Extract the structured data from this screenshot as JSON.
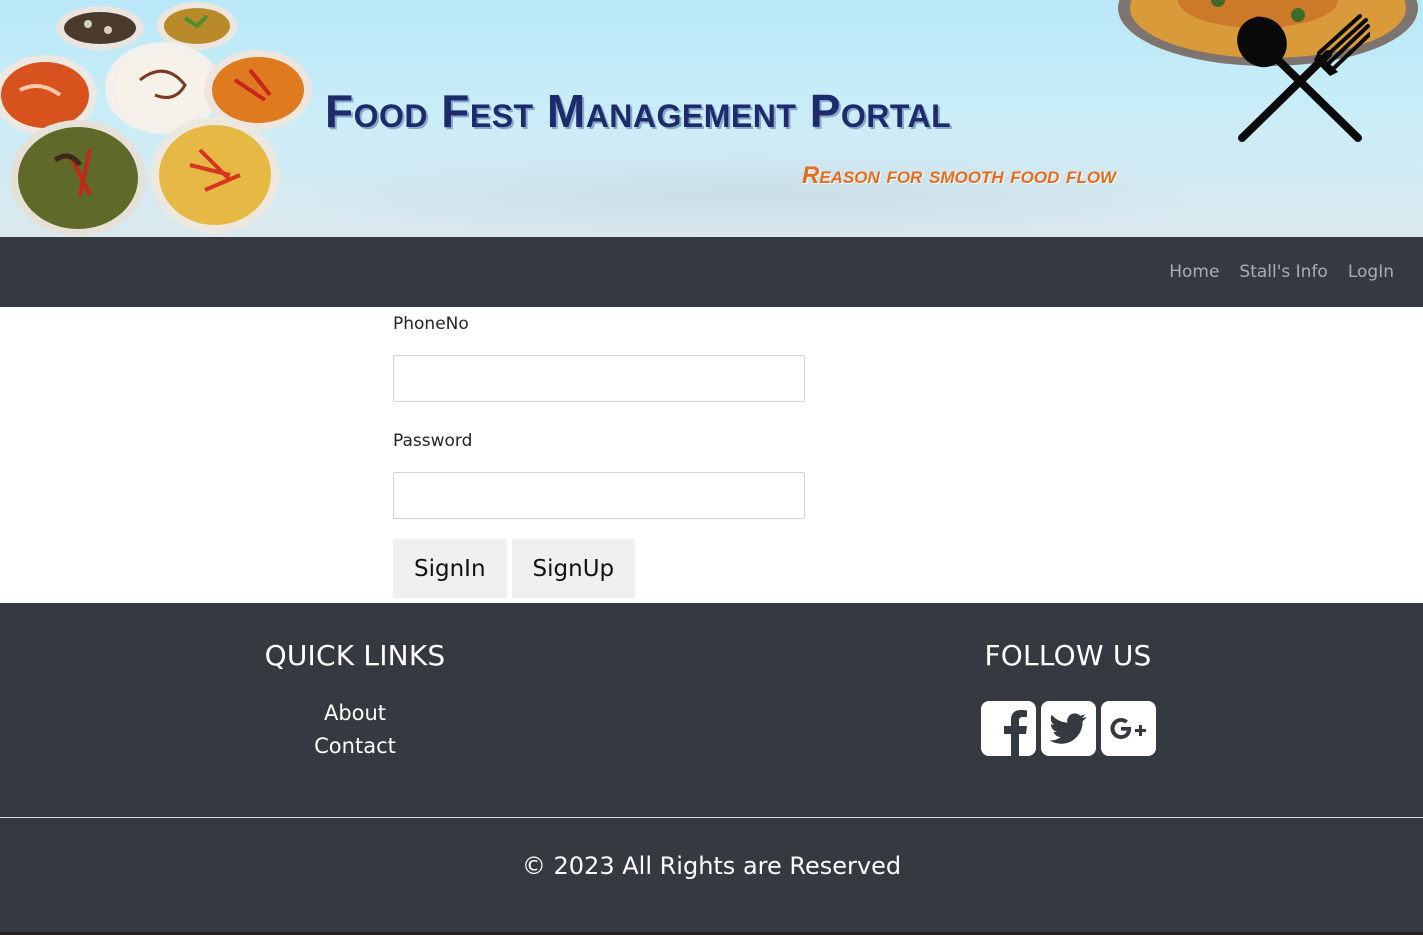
{
  "banner": {
    "title": "Food Fest Management Portal",
    "tagline": "Reason for smooth food flow"
  },
  "nav": {
    "links": [
      {
        "label": "Home"
      },
      {
        "label": "Stall's Info"
      },
      {
        "label": "LogIn"
      }
    ]
  },
  "form": {
    "phone_label": "PhoneNo",
    "phone_value": "",
    "password_label": "Password",
    "password_value": "",
    "signin_label": "SignIn",
    "signup_label": "SignUp"
  },
  "footer": {
    "quick_links_heading": "QUICK LINKS",
    "quick_links": [
      {
        "label": "About"
      },
      {
        "label": "Contact"
      }
    ],
    "follow_heading": "FOLLOW US",
    "social": [
      {
        "icon": "facebook-icon"
      },
      {
        "icon": "twitter-icon"
      },
      {
        "icon": "google-plus-icon"
      }
    ],
    "copyright": "© 2023 All Rights are Reserved"
  },
  "colors": {
    "navbar_bg": "#343a40",
    "footer_bg": "#343a40",
    "title_color": "#1d2a6b",
    "tagline_color": "#ea6a1a",
    "button_bg": "#efefef"
  }
}
